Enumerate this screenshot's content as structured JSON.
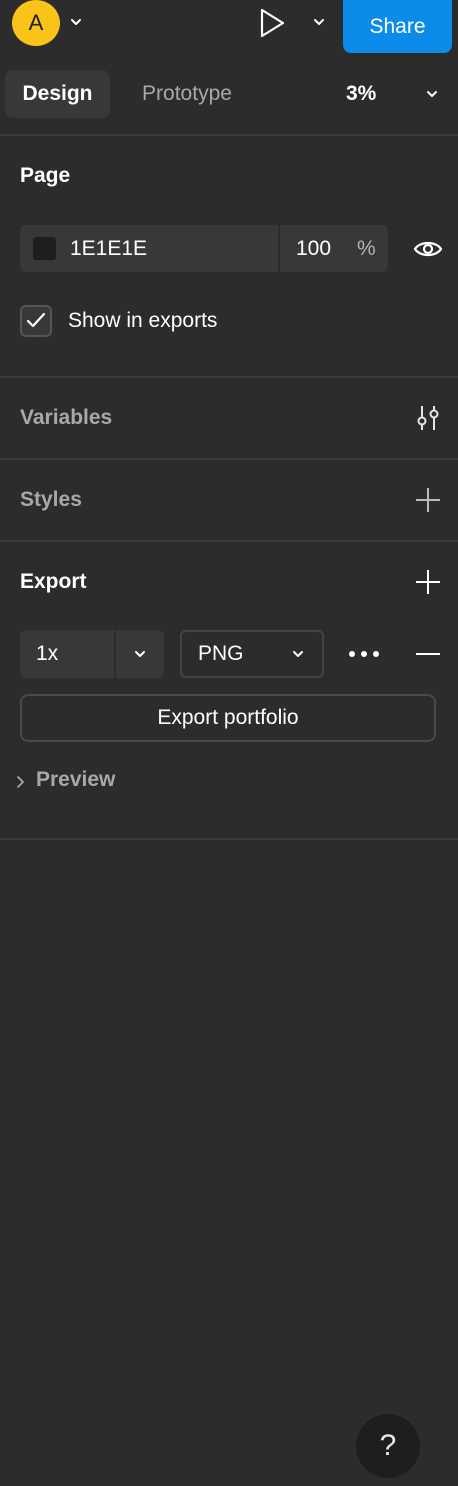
{
  "header": {
    "avatar_initial": "A",
    "share_label": "Share",
    "accent_color": "#0c8ce9",
    "avatar_color": "#f9c31a"
  },
  "tabs": {
    "design_label": "Design",
    "prototype_label": "Prototype",
    "zoom_value": "3%"
  },
  "page_section": {
    "title": "Page",
    "fill_hex": "1E1E1E",
    "fill_color": "#1e1e1e",
    "opacity_value": "100",
    "opacity_unit": "%",
    "show_in_exports_label": "Show in exports",
    "show_in_exports_checked": true
  },
  "variables_section": {
    "title": "Variables",
    "icon": "sliders-icon"
  },
  "styles_section": {
    "title": "Styles",
    "icon": "plus-icon"
  },
  "export_section": {
    "title": "Export",
    "scale_value": "1x",
    "format_value": "PNG",
    "export_button_label": "Export portfolio",
    "preview_label": "Preview"
  },
  "help": {
    "label": "?"
  }
}
